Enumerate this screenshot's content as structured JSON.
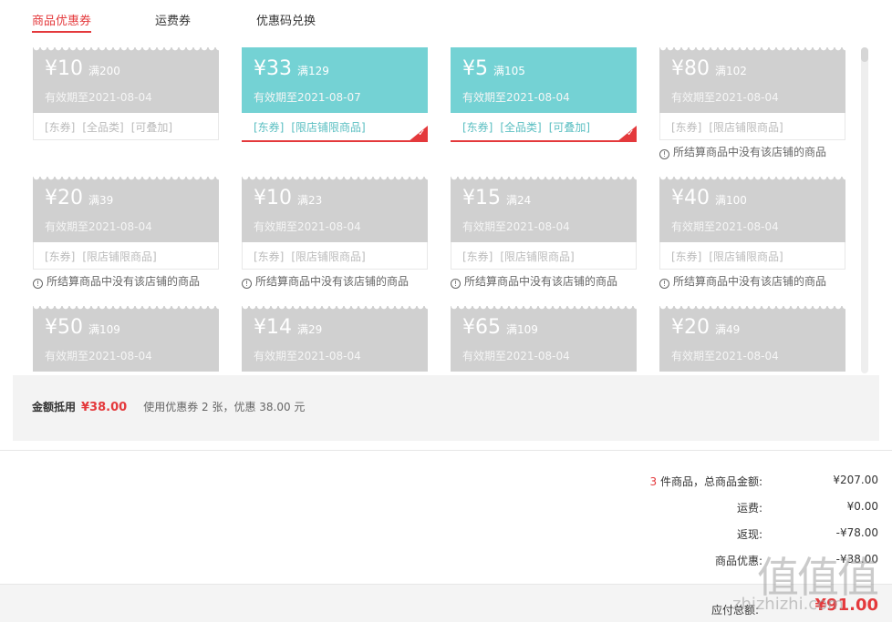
{
  "tabs": {
    "coupons": "商品优惠券",
    "shipping": "运费券",
    "code": "优惠码兑换"
  },
  "coupons": [
    {
      "amount": "¥10",
      "condition": "满200",
      "valid": "有效期至2021-08-04",
      "tags": [
        "[东券]",
        "[全品类]",
        "[可叠加]"
      ],
      "note": ""
    },
    {
      "amount": "¥33",
      "condition": "满129",
      "valid": "有效期至2021-08-07",
      "tags": [
        "[东券]",
        "[限店铺限商品]"
      ],
      "note": ""
    },
    {
      "amount": "¥5",
      "condition": "满105",
      "valid": "有效期至2021-08-04",
      "tags": [
        "[东券]",
        "[全品类]",
        "[可叠加]"
      ],
      "note": ""
    },
    {
      "amount": "¥80",
      "condition": "满102",
      "valid": "有效期至2021-08-04",
      "tags": [
        "[东券]",
        "[限店铺限商品]"
      ],
      "note": "所结算商品中没有该店铺的商品"
    },
    {
      "amount": "¥20",
      "condition": "满39",
      "valid": "有效期至2021-08-04",
      "tags": [
        "[东券]",
        "[限店铺限商品]"
      ],
      "note": "所结算商品中没有该店铺的商品"
    },
    {
      "amount": "¥10",
      "condition": "满23",
      "valid": "有效期至2021-08-04",
      "tags": [
        "[东券]",
        "[限店铺限商品]"
      ],
      "note": "所结算商品中没有该店铺的商品"
    },
    {
      "amount": "¥15",
      "condition": "满24",
      "valid": "有效期至2021-08-04",
      "tags": [
        "[东券]",
        "[限店铺限商品]"
      ],
      "note": "所结算商品中没有该店铺的商品"
    },
    {
      "amount": "¥40",
      "condition": "满100",
      "valid": "有效期至2021-08-04",
      "tags": [
        "[东券]",
        "[限店铺限商品]"
      ],
      "note": "所结算商品中没有该店铺的商品"
    },
    {
      "amount": "¥50",
      "condition": "满109",
      "valid": "有效期至2021-08-04",
      "tags": [],
      "note": ""
    },
    {
      "amount": "¥14",
      "condition": "满29",
      "valid": "有效期至2021-08-04",
      "tags": [],
      "note": ""
    },
    {
      "amount": "¥65",
      "condition": "满109",
      "valid": "有效期至2021-08-04",
      "tags": [],
      "note": ""
    },
    {
      "amount": "¥20",
      "condition": "满49",
      "valid": "有效期至2021-08-04",
      "tags": [],
      "note": ""
    }
  ],
  "selected": [
    1,
    2
  ],
  "summary": {
    "label": "金额抵用",
    "value": "¥38.00",
    "text": "使用优惠券 2 张，优惠 38.00 元"
  },
  "totals": {
    "count": "3",
    "items_label": " 件商品，总商品金额:",
    "items_value": "¥207.00",
    "shipping_label": "运费:",
    "shipping_value": "¥0.00",
    "cashback_label": "返现:",
    "cashback_value": "-¥78.00",
    "discount_label": "商品优惠:",
    "discount_value": "-¥38.00",
    "payable_label": "应付总额:",
    "payable_value": "¥91.00"
  },
  "watermark": {
    "main": "值值值",
    "sub": "zhizhizhi.com"
  },
  "colors": {
    "accent": "#e4393c",
    "selected": "#74d2d4",
    "disabled": "#d0d0d0"
  }
}
